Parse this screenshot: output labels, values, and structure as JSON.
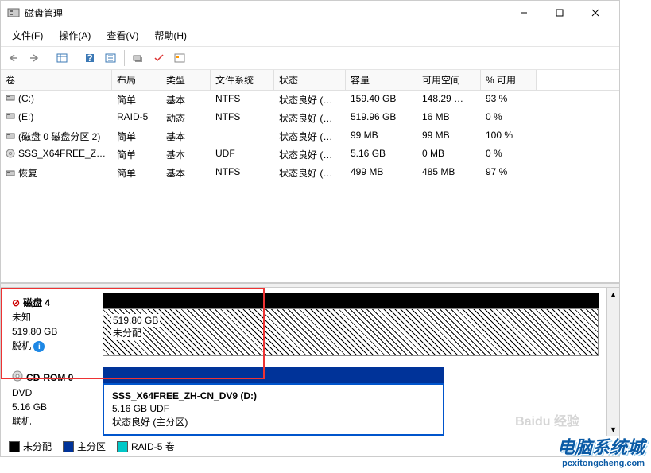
{
  "title": "磁盘管理",
  "menus": [
    "文件(F)",
    "操作(A)",
    "查看(V)",
    "帮助(H)"
  ],
  "columns": [
    "卷",
    "布局",
    "类型",
    "文件系统",
    "状态",
    "容量",
    "可用空间",
    "% 可用"
  ],
  "volumes": [
    {
      "icon": "drive",
      "name": "(C:)",
      "layout": "简单",
      "type": "基本",
      "fs": "NTFS",
      "status": "状态良好 (…",
      "cap": "159.40 GB",
      "free": "148.29 …",
      "pct": "93 %"
    },
    {
      "icon": "drive",
      "name": "(E:)",
      "layout": "RAID-5",
      "type": "动态",
      "fs": "NTFS",
      "status": "状态良好 (…",
      "cap": "519.96 GB",
      "free": "16 MB",
      "pct": "0 %"
    },
    {
      "icon": "drive",
      "name": "(磁盘 0 磁盘分区 2)",
      "layout": "简单",
      "type": "基本",
      "fs": "",
      "status": "状态良好 (…",
      "cap": "99 MB",
      "free": "99 MB",
      "pct": "100 %"
    },
    {
      "icon": "cd",
      "name": "SSS_X64FREE_ZH…",
      "layout": "简单",
      "type": "基本",
      "fs": "UDF",
      "status": "状态良好 (…",
      "cap": "5.16 GB",
      "free": "0 MB",
      "pct": "0 %"
    },
    {
      "icon": "drive",
      "name": "恢复",
      "layout": "简单",
      "type": "基本",
      "fs": "NTFS",
      "status": "状态良好 (…",
      "cap": "499 MB",
      "free": "485 MB",
      "pct": "97 %"
    }
  ],
  "disk4": {
    "title": "磁盘 4",
    "lines": [
      "未知",
      "519.80 GB",
      "脱机"
    ],
    "part_size": "519.80 GB",
    "part_label": "未分配"
  },
  "cdrom": {
    "title": "CD-ROM 0",
    "lines": [
      "DVD",
      "5.16 GB",
      "联机"
    ],
    "part_title": "SSS_X64FREE_ZH-CN_DV9  (D:)",
    "part_size": "5.16 GB UDF",
    "part_status": "状态良好 (主分区)"
  },
  "legend": {
    "unalloc": "未分配",
    "primary": "主分区",
    "raid5": "RAID-5 卷"
  },
  "watermark": {
    "brand": "电脑系统城",
    "url": "pcxitongcheng.com",
    "baidu": "Baidu 经验"
  }
}
